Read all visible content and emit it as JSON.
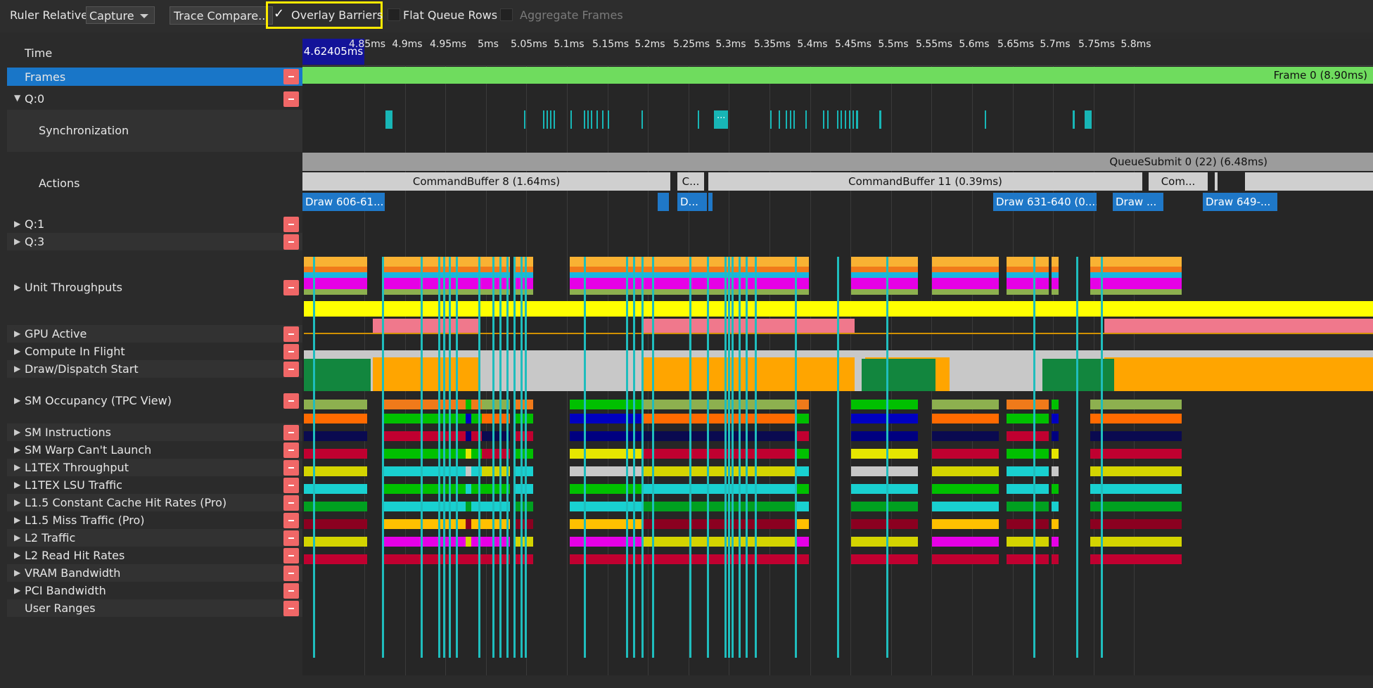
{
  "toolbar": {
    "ruler_relative_label": "Ruler Relative:",
    "ruler_relative_value": "Capture",
    "trace_compare_label": "Trace Compare...",
    "overlay_barriers_label": "Overlay Barriers",
    "overlay_barriers_checked": true,
    "flat_queue_rows_label": "Flat Queue Rows",
    "aggregate_frames_label": "Aggregate Frames"
  },
  "ruler": {
    "row_label": "Time",
    "cursor_value": "4.62405ms",
    "ticks": [
      "4.85ms",
      "4.9ms",
      "4.95ms",
      "5ms",
      "5.05ms",
      "5.1ms",
      "5.15ms",
      "5.2ms",
      "5.25ms",
      "5.3ms",
      "5.35ms",
      "5.4ms",
      "5.45ms",
      "5.5ms",
      "5.55ms",
      "5.6ms",
      "5.65ms",
      "5.7ms",
      "5.75ms",
      "5.8ms"
    ]
  },
  "frames": {
    "label": "Frames",
    "bar_text": "Frame 0 (8.90ms)"
  },
  "queue0": {
    "label": "Q:0",
    "sync_label": "Synchronization",
    "sync_badge": "...",
    "actions_label": "Actions",
    "queue_submit": "QueueSubmit 0 (22) (6.48ms)",
    "command_buffers": [
      "CommandBuffer 8 (1.64ms)",
      "C...",
      "CommandBuffer 11 (0.39ms)",
      "Com..."
    ],
    "draws": [
      "Draw 606-61...",
      "D...",
      "Draw 631-640 (0....",
      "Draw ...",
      "Draw 649-..."
    ]
  },
  "rows": [
    {
      "label": "Q:1",
      "expand": "collapsed"
    },
    {
      "label": "Q:3",
      "expand": "collapsed"
    },
    {
      "label": "Unit Throughputs",
      "expand": "collapsed"
    },
    {
      "label": "GPU Active",
      "expand": "collapsed"
    },
    {
      "label": "Compute In Flight",
      "expand": "collapsed"
    },
    {
      "label": "Draw/Dispatch Start",
      "expand": "collapsed"
    },
    {
      "label": "SM Occupancy (TPC View)",
      "expand": "collapsed"
    },
    {
      "label": "SM Instructions",
      "expand": "collapsed"
    },
    {
      "label": "SM Warp Can't Launch",
      "expand": "collapsed"
    },
    {
      "label": "L1TEX Throughput",
      "expand": "collapsed"
    },
    {
      "label": "L1TEX LSU Traffic",
      "expand": "collapsed"
    },
    {
      "label": "L1.5 Constant Cache Hit Rates (Pro)",
      "expand": "collapsed"
    },
    {
      "label": "L1.5 Miss Traffic (Pro)",
      "expand": "collapsed"
    },
    {
      "label": "L2 Traffic",
      "expand": "collapsed"
    },
    {
      "label": "L2 Read Hit Rates",
      "expand": "collapsed"
    },
    {
      "label": "VRAM Bandwidth",
      "expand": "collapsed"
    },
    {
      "label": "PCI Bandwidth",
      "expand": "collapsed"
    },
    {
      "label": "User Ranges",
      "expand": "none"
    }
  ],
  "colors": {
    "highlight": "#ffea00",
    "selected_row": "#1976c8",
    "frames_bar": "#6fdc5e",
    "barrier": "#1fbdbd",
    "gpu_active": "#ffff00",
    "compute": "#f0788c",
    "sm_occupancy": "#ffa500",
    "draw": "#1f78c8"
  }
}
